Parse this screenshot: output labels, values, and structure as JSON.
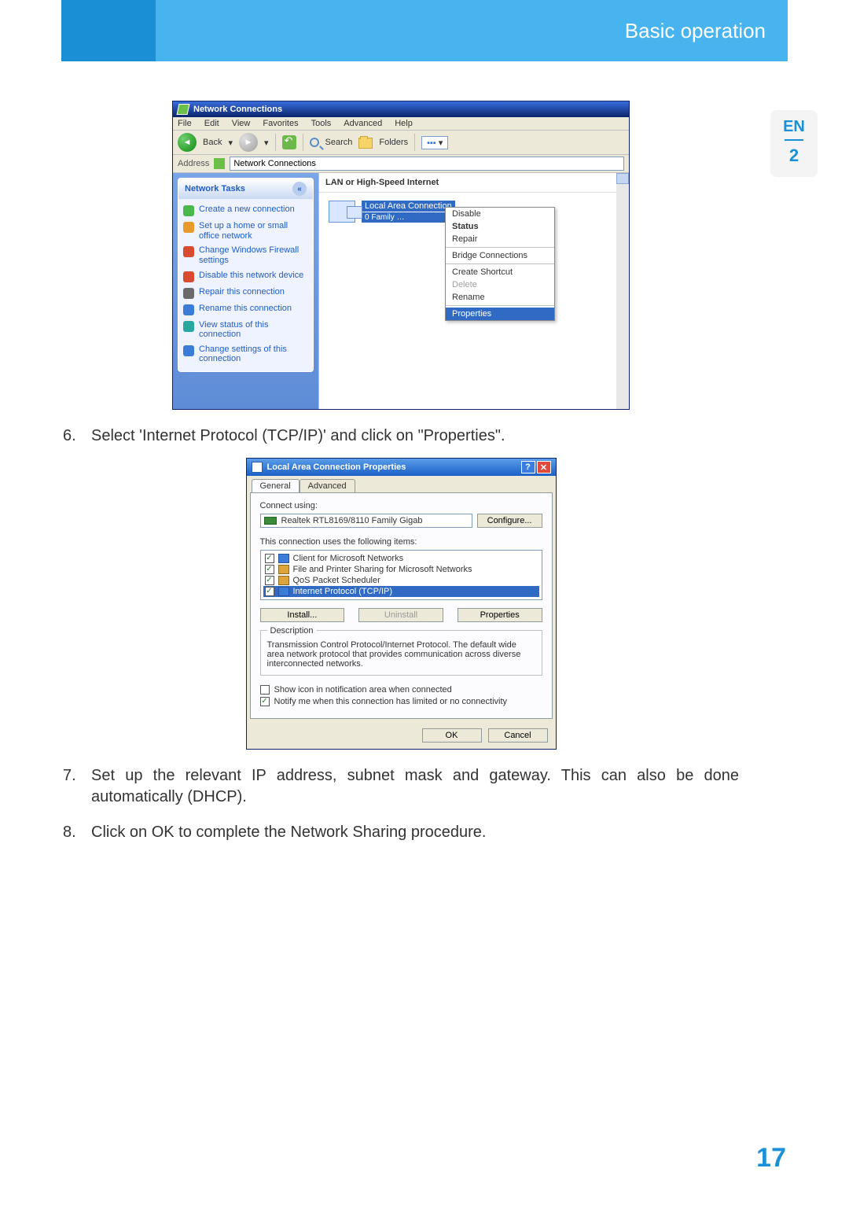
{
  "header": {
    "title": "Basic operation"
  },
  "side": {
    "lang": "EN",
    "chapter": "2"
  },
  "page_num": "17",
  "steps": {
    "s6_num": "6.",
    "s6": "Select 'Internet Protocol (TCP/IP)' and click on \"Properties\".",
    "s7_num": "7.",
    "s7": "Set up the relevant IP address, subnet mask and gateway. This can also be done automatically (DHCP).",
    "s8_num": "8.",
    "s8": "Click on OK to complete the Network Sharing procedure."
  },
  "fig1": {
    "title": "Network Connections",
    "menu": {
      "file": "File",
      "edit": "Edit",
      "view": "View",
      "fav": "Favorites",
      "tools": "Tools",
      "adv": "Advanced",
      "help": "Help"
    },
    "toolbar": {
      "back": "Back",
      "search": "Search",
      "folders": "Folders",
      "views_glyph": "▪▪▪",
      "views_caret": "▾"
    },
    "address": {
      "label": "Address",
      "value": "Network Connections"
    },
    "sidebar": {
      "head": "Network Tasks",
      "items": [
        "Create a new connection",
        "Set up a home or small office network",
        "Change Windows Firewall settings",
        "Disable this network device",
        "Repair this connection",
        "Rename this connection",
        "View status of this connection",
        "Change settings of this connection"
      ]
    },
    "section": "LAN or High-Speed Internet",
    "conn": {
      "name": "Local Area Connection",
      "sub": "0 Family …"
    },
    "ctx": {
      "disable": "Disable",
      "status": "Status",
      "repair": "Repair",
      "bridge": "Bridge Connections",
      "shortcut": "Create Shortcut",
      "delete": "Delete",
      "rename": "Rename",
      "props": "Properties"
    }
  },
  "fig2": {
    "title": "Local Area Connection Properties",
    "tab_general": "General",
    "tab_adv": "Advanced",
    "connect_using": "Connect using:",
    "adapter": "Realtek RTL8169/8110 Family Gigab",
    "configure": "Configure...",
    "uses_label": "This connection uses the following items:",
    "items": [
      "Client for Microsoft Networks",
      "File and Printer Sharing for Microsoft Networks",
      "QoS Packet Scheduler",
      "Internet Protocol (TCP/IP)"
    ],
    "install": "Install...",
    "uninstall": "Uninstall",
    "properties": "Properties",
    "desc_head": "Description",
    "desc_body": "Transmission Control Protocol/Internet Protocol. The default wide area network protocol that provides communication across diverse interconnected networks.",
    "opt_showicon": "Show icon in notification area when connected",
    "opt_notify": "Notify me when this connection has limited or no connectivity",
    "ok": "OK",
    "cancel": "Cancel"
  }
}
